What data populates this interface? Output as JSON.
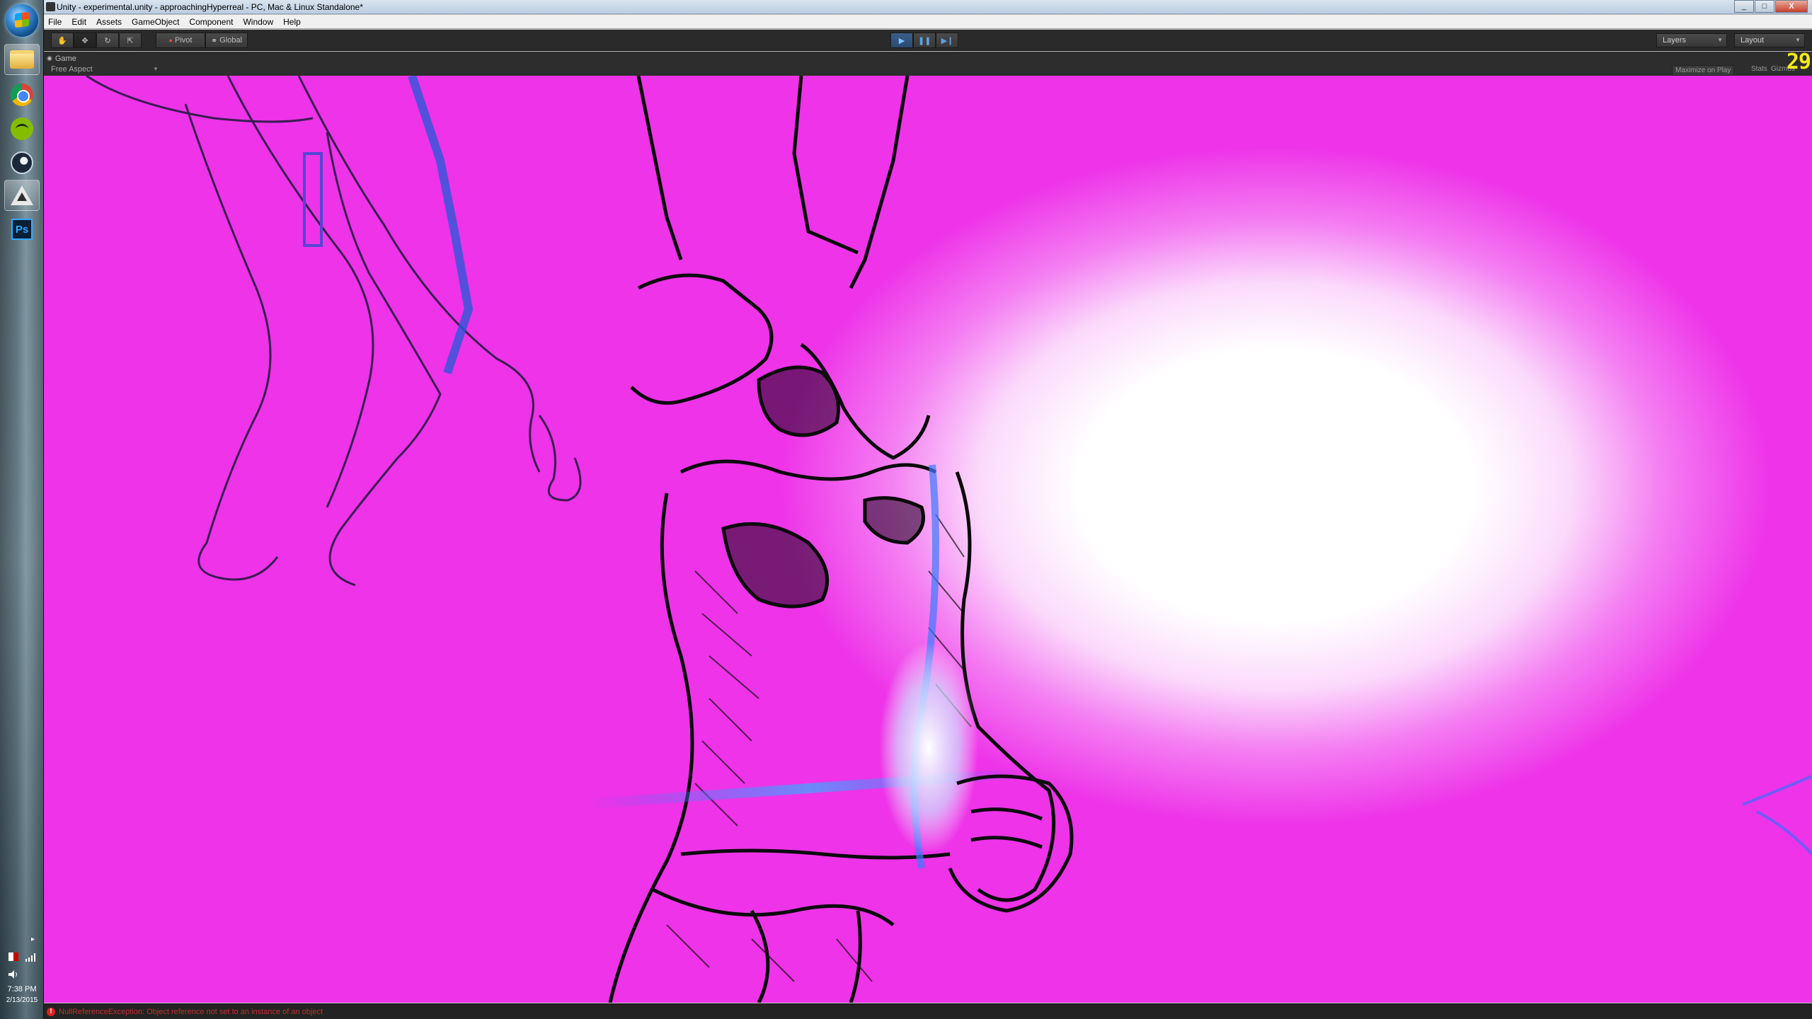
{
  "window": {
    "title": "Unity - experimental.unity - approachingHyperreal - PC, Mac & Linux Standalone*",
    "controls": [
      "_",
      "□",
      "X"
    ]
  },
  "menu": [
    "File",
    "Edit",
    "Assets",
    "GameObject",
    "Component",
    "Window",
    "Help"
  ],
  "toolbar": {
    "pivot_label": "Pivot",
    "global_label": "Global",
    "layers_label": "Layers",
    "layout_label": "Layout"
  },
  "game_view": {
    "tab_label": "Game",
    "aspect_label": "Free Aspect",
    "maximize_label": "Maximize on Play",
    "stats_label": "Stats",
    "gizmos_label": "Gizmos",
    "fps": "29"
  },
  "console": {
    "error_message": "NullReferenceException: Object reference not set to an instance of an object"
  },
  "taskbar": {
    "time": "7:38 PM",
    "date": "2/13/2015",
    "apps": [
      "file-explorer",
      "chrome",
      "spotify",
      "steam",
      "unity",
      "photoshop"
    ],
    "photoshop_label": "Ps"
  },
  "colors": {
    "magenta": "#f13cec",
    "glow": "#ffffff",
    "fps_yellow": "#f2ea18",
    "error_red": "#c23030"
  }
}
